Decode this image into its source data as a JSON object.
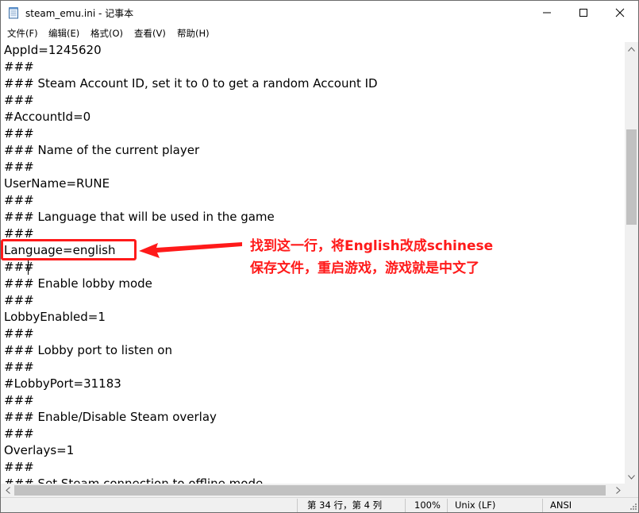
{
  "window": {
    "title": "steam_emu.ini - 记事本",
    "icon": "notepad-icon"
  },
  "menu": [
    "文件(F)",
    "编辑(E)",
    "格式(O)",
    "查看(V)",
    "帮助(H)"
  ],
  "editor": {
    "lines": [
      "AppId=1245620",
      "###",
      "### Steam Account ID, set it to 0 to get a random Account ID",
      "###",
      "#AccountId=0",
      "###",
      "### Name of the current player",
      "###",
      "UserName=RUNE",
      "###",
      "### Language that will be used in the game",
      "###",
      "Language=english",
      "###",
      "### Enable lobby mode",
      "###",
      "LobbyEnabled=1",
      "###",
      "### Lobby port to listen on",
      "###",
      "#LobbyPort=31183",
      "###",
      "### Enable/Disable Steam overlay",
      "###",
      "Overlays=1",
      "###",
      "### Set Steam connection to offline mode"
    ]
  },
  "annotation": {
    "line1": "找到这一行，将English改成schinese",
    "line2": "保存文件，重启游戏，游戏就是中文了",
    "color": "#ff1a1a"
  },
  "status": {
    "position": "第 34 行，第 4 列",
    "zoom": "100%",
    "line_ending": "Unix (LF)",
    "encoding": "ANSI"
  }
}
